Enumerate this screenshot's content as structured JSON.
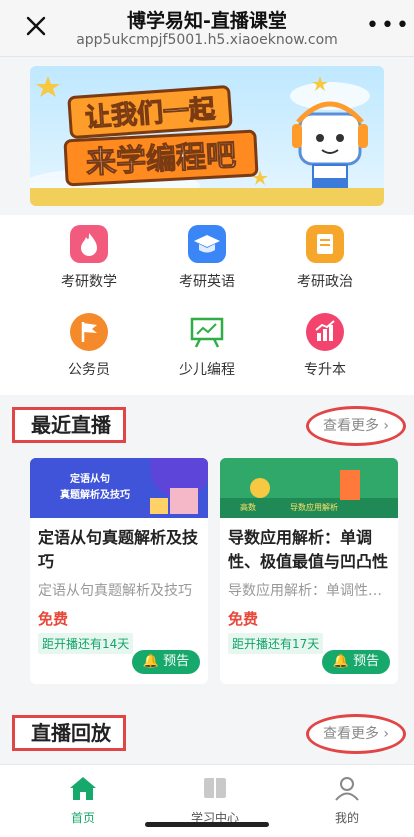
{
  "header": {
    "title": "博学易知-直播课堂",
    "url": "app5ukcmpjf5001.h5.xiaoeknow.com",
    "more_label": "•••"
  },
  "banner": {
    "line1": "让我们一起",
    "line2": "来学编程吧"
  },
  "categories": [
    {
      "label": "考研数学",
      "icon": "flame-icon",
      "color": "#f35b7e"
    },
    {
      "label": "考研英语",
      "icon": "graduation-cap-icon",
      "color": "#3a86f6"
    },
    {
      "label": "考研政治",
      "icon": "document-icon",
      "color": "#f6a62a"
    },
    {
      "label": "公务员",
      "icon": "flag-icon",
      "color": "#f58a2b"
    },
    {
      "label": "少儿编程",
      "icon": "whiteboard-icon",
      "color": "#2fae47"
    },
    {
      "label": "专升本",
      "icon": "chart-icon",
      "color": "#f2446d"
    }
  ],
  "recent_live": {
    "title": "最近直播",
    "more": "查看更多",
    "cards": [
      {
        "thumb_text_1": "定语从句",
        "thumb_text_2": "真题解析及技巧",
        "title": "定语从句真题解析及技巧",
        "subtitle": "定语从句真题解析及技巧",
        "price": "免费",
        "countdown": "距开播还有14天",
        "button": "预告"
      },
      {
        "thumb_text_1": "高数",
        "thumb_text_2": "导数应用解析",
        "title": "导数应用解析：单调性、极值最值与凹凸性",
        "subtitle": "导数应用解析：单调性、极值最值与凹凸性",
        "price": "免费",
        "countdown": "距开播还有17天",
        "button": "预告"
      }
    ]
  },
  "replay": {
    "title": "直播回放",
    "more": "查看更多"
  },
  "tabs": [
    {
      "label": "首页",
      "icon": "home-icon",
      "active": true
    },
    {
      "label": "学习中心",
      "icon": "book-icon",
      "active": false
    },
    {
      "label": "我的",
      "icon": "user-icon",
      "active": false
    }
  ],
  "colors": {
    "accent": "#17a86c",
    "price": "#e8473a",
    "highlight_border": "#e24545"
  }
}
